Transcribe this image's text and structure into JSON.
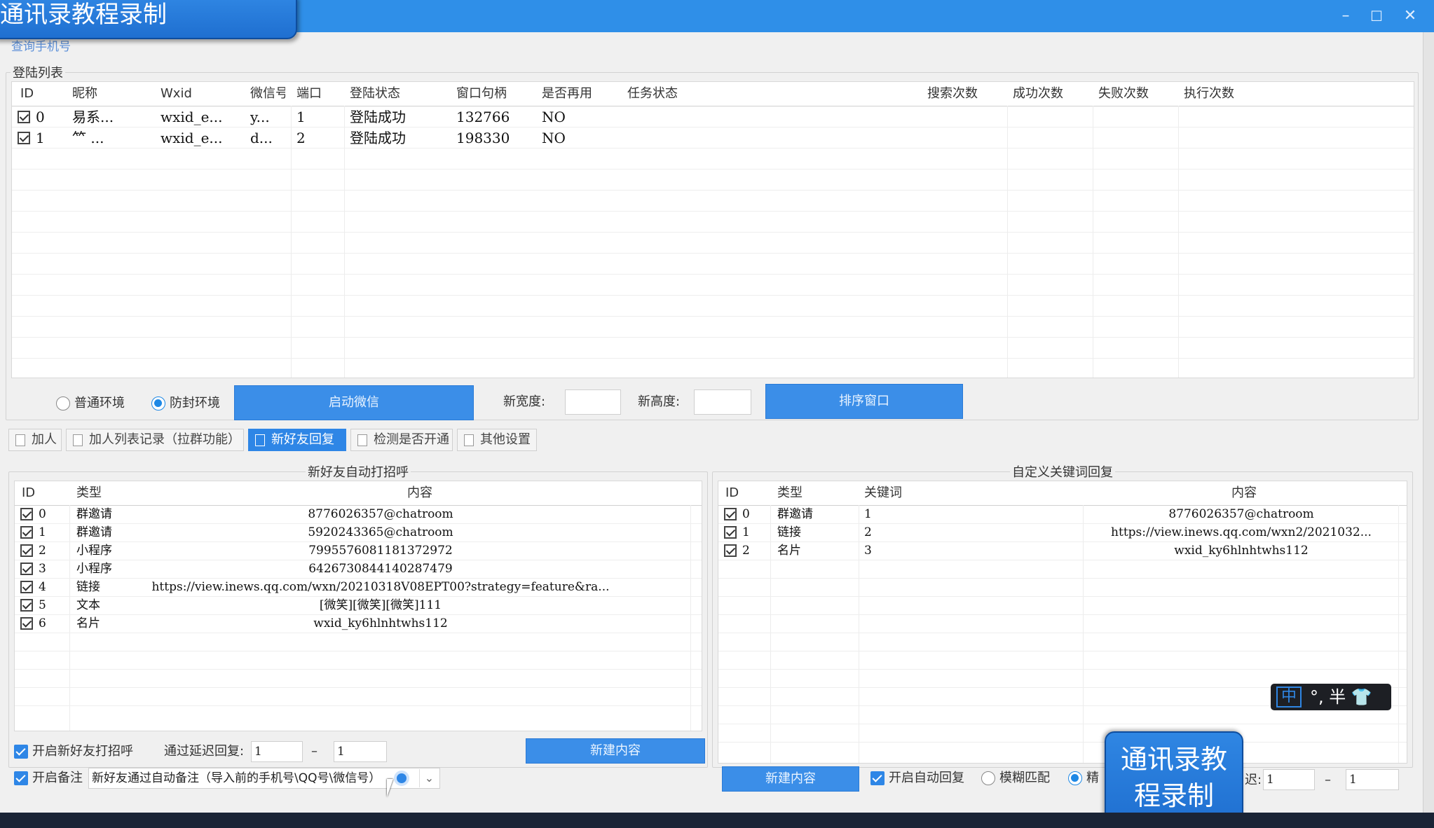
{
  "window": {
    "title_overlay": "通讯录教程录制",
    "controls": [
      "–",
      "☐",
      "✕"
    ]
  },
  "menu_label": "查询手机号",
  "login": {
    "legend": "登陆列表",
    "columns": [
      "ID",
      "昵称",
      "Wxid",
      "微信号",
      "端口",
      "登陆状态",
      "窗口句柄",
      "是否再用",
      "任务状态",
      "搜索次数",
      "成功次数",
      "失败次数",
      "执行次数"
    ],
    "rows": [
      {
        "id": "0",
        "nick": "易系...",
        "wxid": "wxid_e...",
        "wxno": "y...",
        "port": "1",
        "status": "登陆成功",
        "handle": "132766",
        "reuse": "NO"
      },
      {
        "id": "1",
        "nick": "⺮   ...",
        "wxid": "wxid_e...",
        "wxno": "d...",
        "port": "2",
        "status": "登陆成功",
        "handle": "198330",
        "reuse": "NO"
      }
    ]
  },
  "env": {
    "normal": "普通环境",
    "anti": "防封环境",
    "start_button": "启动微信",
    "width_label": "新宽度:",
    "height_label": "新高度:",
    "width_value": "",
    "height_value": "",
    "sort_button": "排序窗口"
  },
  "tabs": [
    "加人",
    "加人列表记录（拉群功能）",
    "新好友回复",
    "检测是否开通",
    "其他设置"
  ],
  "greeting": {
    "legend": "新好友自动打招呼",
    "columns": [
      "ID",
      "类型",
      "内容"
    ],
    "rows": [
      {
        "id": "0",
        "type": "群邀请",
        "content": "8776026357@chatroom"
      },
      {
        "id": "1",
        "type": "群邀请",
        "content": "5920243365@chatroom"
      },
      {
        "id": "2",
        "type": "小程序",
        "content": "7995576081181372972"
      },
      {
        "id": "3",
        "type": "小程序",
        "content": "6426730844140287479"
      },
      {
        "id": "4",
        "type": "链接",
        "content": "https://view.inews.qq.com/wxn/20210318V08EPT00?strategy=feature&ra..."
      },
      {
        "id": "5",
        "type": "文本",
        "content": "[微笑][微笑][微笑]111"
      },
      {
        "id": "6",
        "type": "名片",
        "content": "wxid_ky6hlnhtwhs112"
      }
    ]
  },
  "keyword": {
    "legend": "自定义关键词回复",
    "columns": [
      "ID",
      "类型",
      "关键词",
      "内容"
    ],
    "rows": [
      {
        "id": "0",
        "type": "群邀请",
        "kw": "1",
        "content": "8776026357@chatroom"
      },
      {
        "id": "1",
        "type": "链接",
        "kw": "2",
        "content": "https://view.inews.qq.com/wxn2/2021032..."
      },
      {
        "id": "2",
        "type": "名片",
        "kw": "3",
        "content": "wxid_ky6hlnhtwhs112"
      }
    ]
  },
  "bottom_left": {
    "enable_greet": "开启新好友打招呼",
    "delay_label": "通过延迟回复:",
    "delay_from": "1",
    "dash": "–",
    "delay_to": "1",
    "new_button": "新建内容",
    "enable_remark": "开启备注",
    "remark_value": "新好友通过自动备注（导入前的手机号\\QQ号\\微信号）"
  },
  "bottom_right": {
    "new_button": "新建内容",
    "auto_reply": "开启自动回复",
    "fuzzy": "模糊匹配",
    "exact": "精",
    "delay_suffix": "迟:",
    "delay_from": "1",
    "dash": "–",
    "delay_to": "1"
  },
  "ime": {
    "zh": "中",
    "rest": "°, 半 👕"
  },
  "badge": {
    "line1": "通讯录教",
    "line2": "程录制"
  },
  "colors": {
    "accent": "#2e86e6",
    "titlebar": "#2f8fe8"
  }
}
